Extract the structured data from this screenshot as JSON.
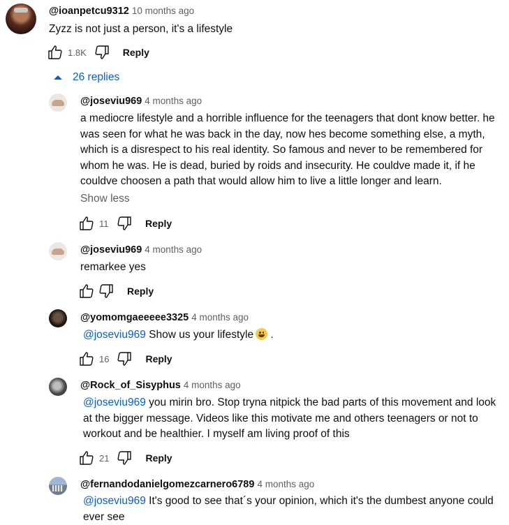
{
  "top_comment": {
    "author": "@ioanpetcu9312",
    "time": "10 months ago",
    "text": "Zyzz is not just a person, it's a lifestyle",
    "likes": "1.8K",
    "reply_label": "Reply"
  },
  "replies_toggle": {
    "label": "26 replies"
  },
  "replies": [
    {
      "author": "@joseviu969",
      "time": "4 months ago",
      "text": "a mediocre lifestyle and a horrible influence for the teenagers that dont know better. he was seen for what he was back in the day, now hes become something else, a myth, which is a disrespect to his real identity. So famous and never to be remembered for whom he was. He is dead, buried by roids and insecurity. He couldve made it, if he couldve choosen a path that would allow him to live a little longer and learn.",
      "show_less": "Show less",
      "likes": "11",
      "reply_label": "Reply"
    },
    {
      "author": "@joseviu969",
      "time": "4 months ago",
      "text": "remarkee yes",
      "likes": "",
      "reply_label": "Reply"
    },
    {
      "author": "@yomomgaeeeee3325",
      "time": "4 months ago",
      "mention": "@joseviu969",
      "text": " Show us your lifestyle",
      "text_after_emoji": " .",
      "emoji": "grinning-face-emoji",
      "likes": "16",
      "reply_label": "Reply"
    },
    {
      "author": "@Rock_of_Sisyphus",
      "time": "4 months ago",
      "mention": "@joseviu969",
      "text": " you mirin bro. Stop tryna nitpick the bad parts of this movement and look at the bigger message. Videos like this motivate me and others teenagers or not to workout and be healthier. I myself am living proof of this",
      "likes": "21",
      "reply_label": "Reply"
    },
    {
      "author": "@fernandodanielgomezcarnero6789",
      "time": "4 months ago",
      "mention": "@joseviu969",
      "text": " It's good to see that´s your opinion, which it's the dumbest anyone could ever see"
    }
  ],
  "colors": {
    "link": "#065fd4",
    "secondary": "#606060",
    "primary": "#0f0f0f"
  }
}
